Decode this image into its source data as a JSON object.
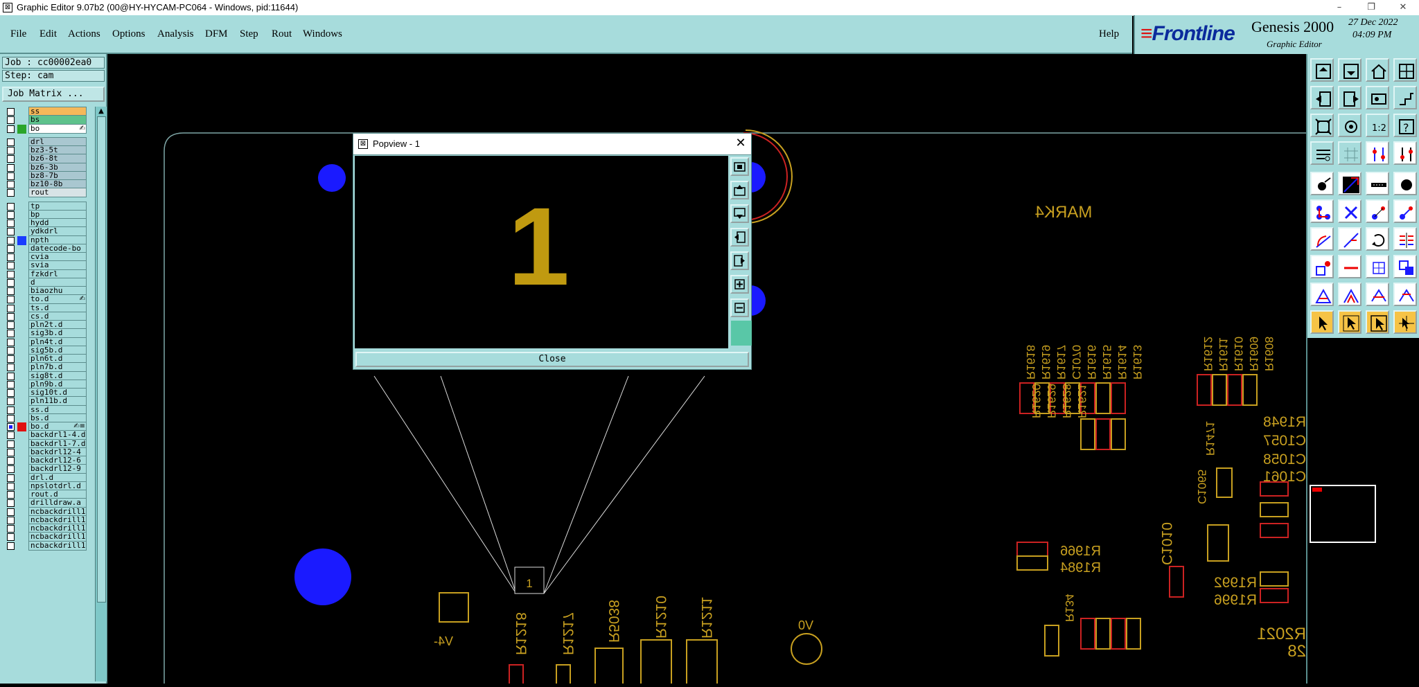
{
  "window": {
    "title": "Graphic Editor 9.07b2 (00@HY-HYCAM-PC064 - Windows, pid:11644)",
    "minimize": "–",
    "restore": "❐",
    "close": "✕"
  },
  "menubar": {
    "items": [
      {
        "label": "File"
      },
      {
        "label": "Edit"
      },
      {
        "label": "Actions"
      },
      {
        "label": "Options"
      },
      {
        "label": "Analysis"
      },
      {
        "label": "DFM"
      },
      {
        "label": "Step"
      },
      {
        "label": "Rout"
      },
      {
        "label": "Windows"
      }
    ],
    "help": "Help"
  },
  "brand": {
    "logo": "Frontline",
    "product": "Genesis 2000",
    "subtitle": "Graphic Editor",
    "date": "27 Dec 2022",
    "time": "04:09 PM"
  },
  "leftpanel": {
    "job": "Job : cc00002ea0",
    "step": "Step: cam",
    "job_matrix": "Job Matrix ...",
    "layers": [
      {
        "name": "ss",
        "style": "orange"
      },
      {
        "name": "bs",
        "style": "green"
      },
      {
        "name": "bo",
        "style": "white",
        "swatch": "#2aa52a",
        "mark": "✍"
      },
      {
        "name": "drl",
        "style": "gray"
      },
      {
        "name": "bz3-5t",
        "style": "gray"
      },
      {
        "name": "bz6-8t",
        "style": "gray"
      },
      {
        "name": "bz6-3b",
        "style": "gray"
      },
      {
        "name": "bz8-7b",
        "style": "gray"
      },
      {
        "name": "bz10-8b",
        "style": "gray"
      },
      {
        "name": "rout",
        "style": "lgray"
      },
      {
        "name": "tp"
      },
      {
        "name": "bp"
      },
      {
        "name": "hydd"
      },
      {
        "name": "ydkdrl"
      },
      {
        "name": "npth",
        "swatch": "#1a3cff"
      },
      {
        "name": "datecode-bo"
      },
      {
        "name": "cvia"
      },
      {
        "name": "svia"
      },
      {
        "name": "fzkdrl"
      },
      {
        "name": "d"
      },
      {
        "name": "biaozhu"
      },
      {
        "name": "to.d",
        "mark": "✍"
      },
      {
        "name": "ts.d"
      },
      {
        "name": "cs.d"
      },
      {
        "name": "pln2t.d"
      },
      {
        "name": "sig3b.d"
      },
      {
        "name": "pln4t.d"
      },
      {
        "name": "sig5b.d"
      },
      {
        "name": "pln6t.d"
      },
      {
        "name": "pln7b.d"
      },
      {
        "name": "sig8t.d"
      },
      {
        "name": "pln9b.d"
      },
      {
        "name": "sig10t.d"
      },
      {
        "name": "pln11b.d"
      },
      {
        "name": "ss.d"
      },
      {
        "name": "bs.d"
      },
      {
        "name": "bo.d",
        "swatch": "#e01010",
        "mark": "✍≡",
        "checked": true
      },
      {
        "name": "backdrl1-4.d"
      },
      {
        "name": "backdrl1-7.d"
      },
      {
        "name": "backdrl12-4"
      },
      {
        "name": "backdrl12-6"
      },
      {
        "name": "backdrl12-9"
      },
      {
        "name": "drl.d"
      },
      {
        "name": "npslotdrl.d"
      },
      {
        "name": "rout.d"
      },
      {
        "name": "drilldraw.a"
      },
      {
        "name": "ncbackdrill1"
      },
      {
        "name": "ncbackdrill1"
      },
      {
        "name": "ncbackdrill1"
      },
      {
        "name": "ncbackdrill1"
      },
      {
        "name": "ncbackdrill1"
      }
    ]
  },
  "canvas": {
    "labels": [
      {
        "text": "MARK4"
      },
      {
        "text": "R1618"
      },
      {
        "text": "R1619"
      },
      {
        "text": "R1617"
      },
      {
        "text": "C1070"
      },
      {
        "text": "R1616"
      },
      {
        "text": "R1615"
      },
      {
        "text": "R1614"
      },
      {
        "text": "R1613"
      },
      {
        "text": "R1612"
      },
      {
        "text": "R1611"
      },
      {
        "text": "R1610"
      },
      {
        "text": "R1609"
      },
      {
        "text": "R1608"
      },
      {
        "text": "R1948"
      },
      {
        "text": "C1057"
      },
      {
        "text": "C1058"
      },
      {
        "text": "C1061"
      },
      {
        "text": "R1620"
      },
      {
        "text": "R1629"
      },
      {
        "text": "R1628"
      },
      {
        "text": "R1621"
      },
      {
        "text": "R1471"
      },
      {
        "text": "C1065"
      },
      {
        "text": "R1966"
      },
      {
        "text": "R1984"
      },
      {
        "text": "C1010"
      },
      {
        "text": "R1992"
      },
      {
        "text": "R1996"
      },
      {
        "text": "R2021"
      },
      {
        "text": "28"
      },
      {
        "text": "R134"
      },
      {
        "text": "R1218"
      },
      {
        "text": "R1217"
      },
      {
        "text": "R5038"
      },
      {
        "text": "R1210"
      },
      {
        "text": "R1211"
      },
      {
        "text": "V0"
      },
      {
        "text": "V4-"
      },
      {
        "text": "1"
      }
    ]
  },
  "popview": {
    "title": "Popview - 1",
    "close_glyph": "✕",
    "display": "1",
    "close_button": "Close"
  }
}
